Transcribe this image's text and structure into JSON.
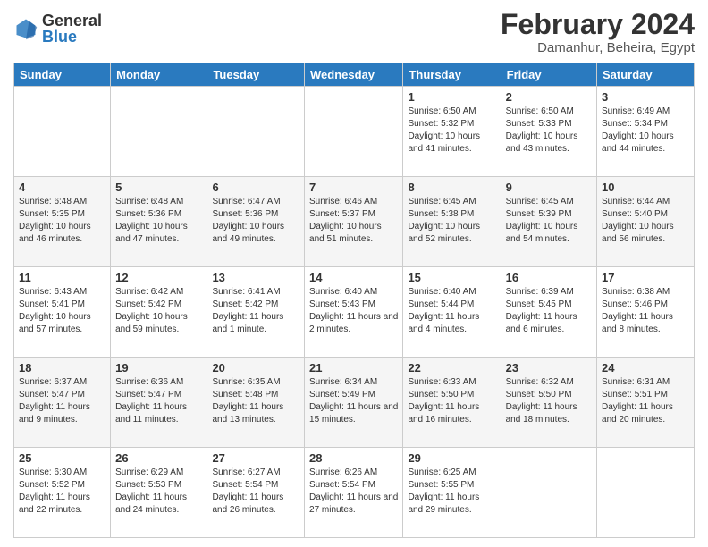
{
  "header": {
    "logo": {
      "general": "General",
      "blue": "Blue"
    },
    "title": "February 2024",
    "location": "Damanhur, Beheira, Egypt"
  },
  "days_of_week": [
    "Sunday",
    "Monday",
    "Tuesday",
    "Wednesday",
    "Thursday",
    "Friday",
    "Saturday"
  ],
  "weeks": [
    [
      {
        "day": "",
        "info": ""
      },
      {
        "day": "",
        "info": ""
      },
      {
        "day": "",
        "info": ""
      },
      {
        "day": "",
        "info": ""
      },
      {
        "day": "1",
        "info": "Sunrise: 6:50 AM\nSunset: 5:32 PM\nDaylight: 10 hours and 41 minutes."
      },
      {
        "day": "2",
        "info": "Sunrise: 6:50 AM\nSunset: 5:33 PM\nDaylight: 10 hours and 43 minutes."
      },
      {
        "day": "3",
        "info": "Sunrise: 6:49 AM\nSunset: 5:34 PM\nDaylight: 10 hours and 44 minutes."
      }
    ],
    [
      {
        "day": "4",
        "info": "Sunrise: 6:48 AM\nSunset: 5:35 PM\nDaylight: 10 hours and 46 minutes."
      },
      {
        "day": "5",
        "info": "Sunrise: 6:48 AM\nSunset: 5:36 PM\nDaylight: 10 hours and 47 minutes."
      },
      {
        "day": "6",
        "info": "Sunrise: 6:47 AM\nSunset: 5:36 PM\nDaylight: 10 hours and 49 minutes."
      },
      {
        "day": "7",
        "info": "Sunrise: 6:46 AM\nSunset: 5:37 PM\nDaylight: 10 hours and 51 minutes."
      },
      {
        "day": "8",
        "info": "Sunrise: 6:45 AM\nSunset: 5:38 PM\nDaylight: 10 hours and 52 minutes."
      },
      {
        "day": "9",
        "info": "Sunrise: 6:45 AM\nSunset: 5:39 PM\nDaylight: 10 hours and 54 minutes."
      },
      {
        "day": "10",
        "info": "Sunrise: 6:44 AM\nSunset: 5:40 PM\nDaylight: 10 hours and 56 minutes."
      }
    ],
    [
      {
        "day": "11",
        "info": "Sunrise: 6:43 AM\nSunset: 5:41 PM\nDaylight: 10 hours and 57 minutes."
      },
      {
        "day": "12",
        "info": "Sunrise: 6:42 AM\nSunset: 5:42 PM\nDaylight: 10 hours and 59 minutes."
      },
      {
        "day": "13",
        "info": "Sunrise: 6:41 AM\nSunset: 5:42 PM\nDaylight: 11 hours and 1 minute."
      },
      {
        "day": "14",
        "info": "Sunrise: 6:40 AM\nSunset: 5:43 PM\nDaylight: 11 hours and 2 minutes."
      },
      {
        "day": "15",
        "info": "Sunrise: 6:40 AM\nSunset: 5:44 PM\nDaylight: 11 hours and 4 minutes."
      },
      {
        "day": "16",
        "info": "Sunrise: 6:39 AM\nSunset: 5:45 PM\nDaylight: 11 hours and 6 minutes."
      },
      {
        "day": "17",
        "info": "Sunrise: 6:38 AM\nSunset: 5:46 PM\nDaylight: 11 hours and 8 minutes."
      }
    ],
    [
      {
        "day": "18",
        "info": "Sunrise: 6:37 AM\nSunset: 5:47 PM\nDaylight: 11 hours and 9 minutes."
      },
      {
        "day": "19",
        "info": "Sunrise: 6:36 AM\nSunset: 5:47 PM\nDaylight: 11 hours and 11 minutes."
      },
      {
        "day": "20",
        "info": "Sunrise: 6:35 AM\nSunset: 5:48 PM\nDaylight: 11 hours and 13 minutes."
      },
      {
        "day": "21",
        "info": "Sunrise: 6:34 AM\nSunset: 5:49 PM\nDaylight: 11 hours and 15 minutes."
      },
      {
        "day": "22",
        "info": "Sunrise: 6:33 AM\nSunset: 5:50 PM\nDaylight: 11 hours and 16 minutes."
      },
      {
        "day": "23",
        "info": "Sunrise: 6:32 AM\nSunset: 5:50 PM\nDaylight: 11 hours and 18 minutes."
      },
      {
        "day": "24",
        "info": "Sunrise: 6:31 AM\nSunset: 5:51 PM\nDaylight: 11 hours and 20 minutes."
      }
    ],
    [
      {
        "day": "25",
        "info": "Sunrise: 6:30 AM\nSunset: 5:52 PM\nDaylight: 11 hours and 22 minutes."
      },
      {
        "day": "26",
        "info": "Sunrise: 6:29 AM\nSunset: 5:53 PM\nDaylight: 11 hours and 24 minutes."
      },
      {
        "day": "27",
        "info": "Sunrise: 6:27 AM\nSunset: 5:54 PM\nDaylight: 11 hours and 26 minutes."
      },
      {
        "day": "28",
        "info": "Sunrise: 6:26 AM\nSunset: 5:54 PM\nDaylight: 11 hours and 27 minutes."
      },
      {
        "day": "29",
        "info": "Sunrise: 6:25 AM\nSunset: 5:55 PM\nDaylight: 11 hours and 29 minutes."
      },
      {
        "day": "",
        "info": ""
      },
      {
        "day": "",
        "info": ""
      }
    ]
  ]
}
